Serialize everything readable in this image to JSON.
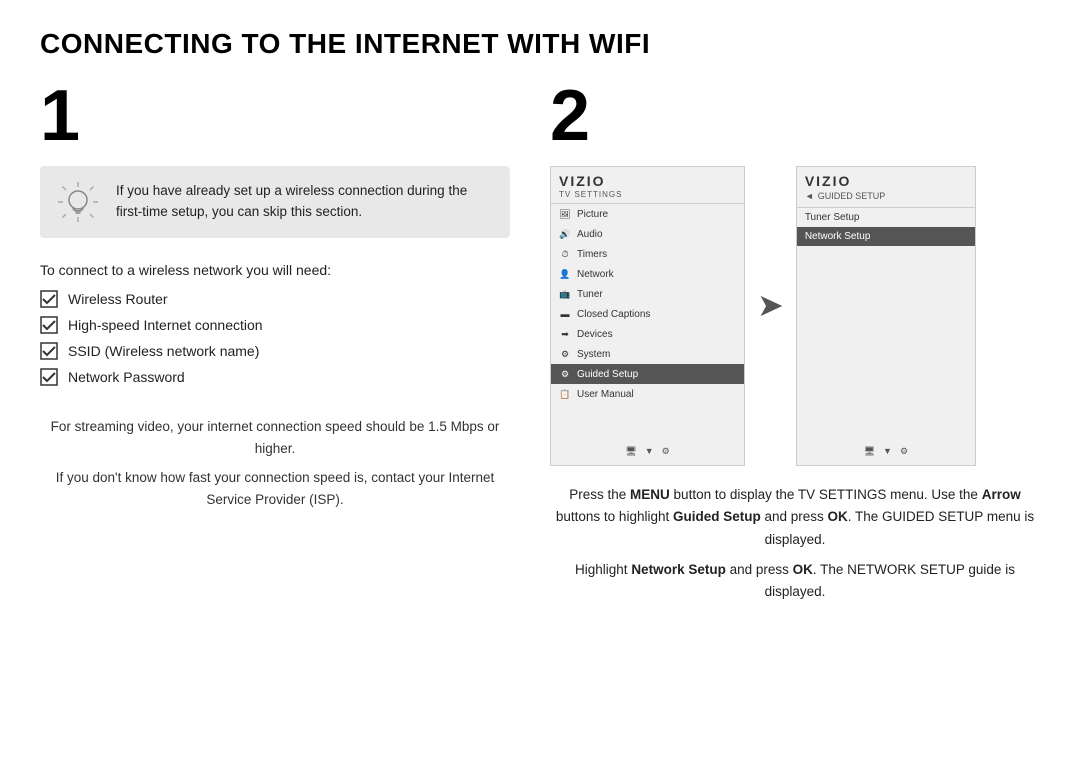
{
  "title": "CONNECTING TO THE INTERNET WITH WIFI",
  "step1": {
    "number": "1",
    "infoBox": {
      "text": "If you have already set up a wireless connection during the first-time setup, you can skip this section."
    },
    "connectText": "To connect to a wireless network you will need:",
    "checklist": [
      "Wireless Router",
      "High-speed Internet connection",
      "SSID (Wireless network name)",
      "Network Password"
    ],
    "streamingInfo": [
      "For streaming video, your internet connection speed should be 1.5 Mbps or higher.",
      "If you don't know how fast your connection speed is, contact your Internet Service Provider (ISP)."
    ]
  },
  "step2": {
    "number": "2",
    "screen1": {
      "brand": "VIZIO",
      "subtitle": "TV SETTINGS",
      "menuItems": [
        {
          "icon": "🖼",
          "label": "Picture"
        },
        {
          "icon": "🔊",
          "label": "Audio"
        },
        {
          "icon": "⏱",
          "label": "Timers"
        },
        {
          "icon": "🌐",
          "label": "Network"
        },
        {
          "icon": "📺",
          "label": "Tuner"
        },
        {
          "icon": "▬",
          "label": "Closed Captions"
        },
        {
          "icon": "➡",
          "label": "Devices"
        },
        {
          "icon": "⚙",
          "label": "System"
        },
        {
          "icon": "⚙",
          "label": "Guided Setup",
          "highlighted": true
        },
        {
          "icon": "📋",
          "label": "User Manual"
        }
      ],
      "footer": [
        "🖥",
        "▼",
        "⚙"
      ]
    },
    "screen2": {
      "brand": "VIZIO",
      "backLabel": "◄  GUIDED SETUP",
      "menuItems": [
        {
          "label": "Tuner Setup",
          "highlighted": false
        },
        {
          "label": "Network Setup",
          "highlighted": true
        }
      ],
      "footer": [
        "🖥",
        "▼",
        "⚙"
      ]
    },
    "instructions": [
      "Press the <b>MENU</b> button to display the TV SETTINGS menu.",
      "Use the <b>Arrow</b> buttons to highlight <b>Guided Setup</b> and press <b>OK</b>. The GUIDED SETUP menu is displayed.",
      "Highlight <b>Network Setup</b> and press <b>OK</b>. The NETWORK SETUP guide is displayed."
    ]
  }
}
